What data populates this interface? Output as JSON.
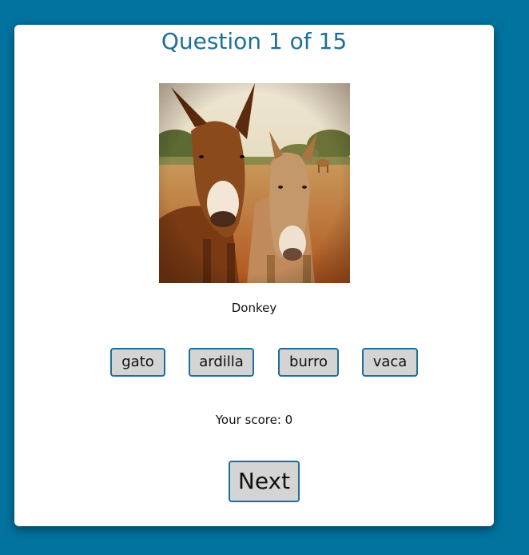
{
  "quiz": {
    "question_label": "Question 1 of 15",
    "image_caption": "Donkey",
    "options": [
      "gato",
      "ardilla",
      "burro",
      "vaca"
    ],
    "score_text": "Your score: 0",
    "next_label": "Next"
  },
  "colors": {
    "background": "#02739e",
    "title": "#1d6f97",
    "button_fill": "#d4d4d4",
    "button_border": "#1d6f97"
  }
}
